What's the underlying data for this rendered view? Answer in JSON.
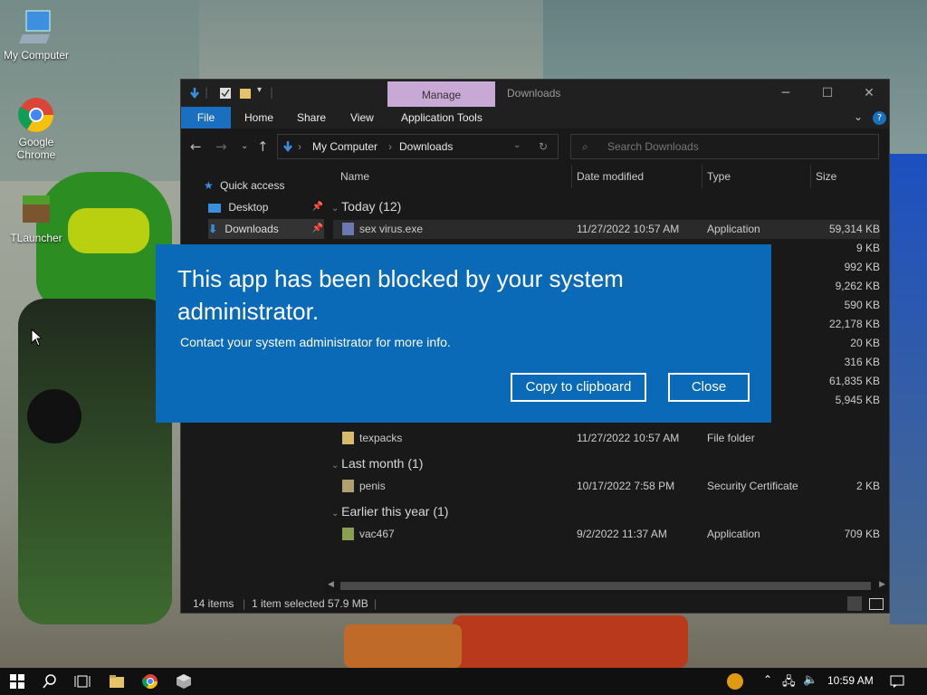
{
  "desktop": {
    "icons": [
      {
        "label": "My Computer"
      },
      {
        "label": "Google Chrome"
      },
      {
        "label": "TLauncher"
      }
    ]
  },
  "explorer": {
    "title": "Downloads",
    "manage_tab": "Manage",
    "ribbon_tabs": [
      "File",
      "Home",
      "Share",
      "View",
      "Application Tools"
    ],
    "address": {
      "segments": [
        "My Computer",
        "Downloads"
      ]
    },
    "search_placeholder": "Search Downloads",
    "nav_pane": {
      "quick_access": "Quick access",
      "items": [
        "Desktop",
        "Downloads"
      ]
    },
    "columns": [
      "Name",
      "Date modified",
      "Type",
      "Size"
    ],
    "groups": [
      {
        "label": "Today (12)"
      },
      {
        "label": "Last month (1)"
      },
      {
        "label": "Earlier this year (1)"
      }
    ],
    "rows": [
      {
        "name": "sex virus.exe",
        "date": "11/27/2022 10:57 AM",
        "type": "Application",
        "size": "59,314 KB"
      },
      {
        "name": "",
        "date": "",
        "type": "",
        "size": "9 KB"
      },
      {
        "name": "",
        "date": "",
        "type": "",
        "size": "992 KB"
      },
      {
        "name": "",
        "date": "",
        "type": "",
        "size": "9,262 KB"
      },
      {
        "name": "",
        "date": "",
        "type": "",
        "size": "590 KB"
      },
      {
        "name": "",
        "date": "",
        "type": "",
        "size": "22,178 KB"
      },
      {
        "name": "",
        "date": "",
        "type": "",
        "size": "20 KB"
      },
      {
        "name": "",
        "date": "",
        "type": "",
        "size": "316 KB"
      },
      {
        "name": "",
        "date": "",
        "type": "",
        "size": "61,835 KB"
      },
      {
        "name": "",
        "date": "",
        "type": "",
        "size": "5,945 KB"
      },
      {
        "name": "texpacks",
        "date": "11/27/2022 10:57 AM",
        "type": "File folder",
        "size": ""
      },
      {
        "name": "penis",
        "date": "10/17/2022 7:58 PM",
        "type": "Security Certificate",
        "size": "2 KB"
      },
      {
        "name": "vac467",
        "date": "9/2/2022 11:37 AM",
        "type": "Application",
        "size": "709 KB"
      }
    ],
    "status": {
      "items": "14 items",
      "selected": "1 item selected  57.9 MB"
    }
  },
  "dialog": {
    "title": "This app has been blocked by your system administrator.",
    "message": "Contact your system administrator for more info.",
    "copy_button": "Copy to clipboard",
    "close_button": "Close"
  },
  "taskbar": {
    "clock": "10:59 AM"
  },
  "colors": {
    "dialog_bg": "#0a6ab8",
    "accent": "#1a6fc0",
    "manage_tab": "#c8a8d4"
  }
}
